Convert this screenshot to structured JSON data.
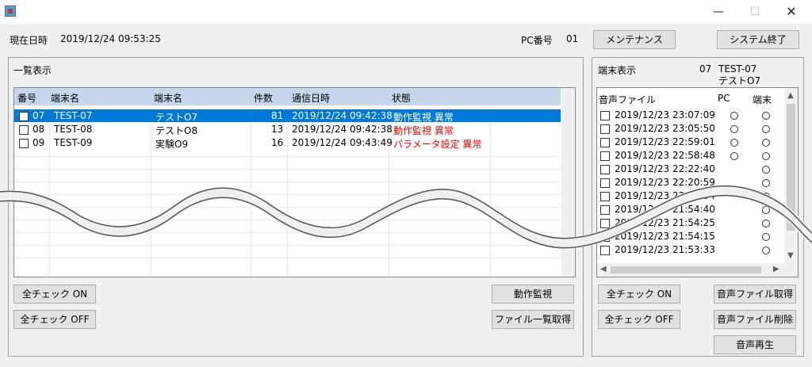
{
  "window": {
    "min_glyph": "—",
    "max_glyph": "☐",
    "close_glyph": "✕"
  },
  "header": {
    "datetime_label": "現在日時",
    "datetime_value": "2019/12/24 09:53:25",
    "pc_label": "PC番号",
    "pc_value": "01",
    "maintenance_button": "メンテナンス",
    "shutdown_button": "システム終了"
  },
  "list_panel": {
    "title": "一覧表示",
    "columns": [
      "番号",
      "端末名",
      "端末名",
      "件数",
      "通信日時",
      "状態"
    ],
    "rows": [
      {
        "no": "07",
        "terminal": "TEST-07",
        "name": "テストO7",
        "count": "81",
        "datetime": "2019/12/24 09:42:38",
        "status": "動作監視 異常"
      },
      {
        "no": "08",
        "terminal": "TEST-08",
        "name": "テストO8",
        "count": "13",
        "datetime": "2019/12/24 09:42:38",
        "status": "動作監視 異常"
      },
      {
        "no": "09",
        "terminal": "TEST-09",
        "name": "実験O9",
        "count": "16",
        "datetime": "2019/12/24 09:43:49",
        "status": "パラメータ設定 異常"
      }
    ],
    "check_on_button": "全チェック ON",
    "check_off_button": "全チェック OFF",
    "monitor_button": "動作監視",
    "filelist_button": "ファイル一覧取得"
  },
  "terminal_panel": {
    "title": "端末表示",
    "terminal_no": "07",
    "terminal_id": "TEST-07",
    "terminal_name": "テストO7",
    "columns": [
      "音声ファイル",
      "PC",
      "端末"
    ],
    "files": [
      {
        "datetime": "2019/12/23 23:07:09",
        "pc": true,
        "terminal": true
      },
      {
        "datetime": "2019/12/23 23:05:50",
        "pc": true,
        "terminal": true
      },
      {
        "datetime": "2019/12/23 22:59:01",
        "pc": true,
        "terminal": true
      },
      {
        "datetime": "2019/12/23 22:58:48",
        "pc": true,
        "terminal": true
      },
      {
        "datetime": "2019/12/23 22:22:40",
        "pc": false,
        "terminal": true
      },
      {
        "datetime": "2019/12/23 22:20:59",
        "pc": false,
        "terminal": true
      },
      {
        "datetime": "2019/12/23 22:19:54",
        "pc": false,
        "terminal": true
      },
      {
        "datetime": "2019/12/23 21:54:40",
        "pc": false,
        "terminal": true
      },
      {
        "datetime": "2019/12/23 21:54:25",
        "pc": false,
        "terminal": true
      },
      {
        "datetime": "2019/12/23 21:54:15",
        "pc": false,
        "terminal": true
      },
      {
        "datetime": "2019/12/23 21:53:33",
        "pc": false,
        "terminal": true
      }
    ],
    "check_on_button": "全チェック ON",
    "check_off_button": "全チェック OFF",
    "get_audio_button": "音声ファイル取得",
    "delete_audio_button": "音声ファイル削除",
    "play_audio_button": "音声再生"
  },
  "colors": {
    "selected_row": "#0078d7",
    "error_text": "#ff0000",
    "header_row": "#c6d6ec"
  }
}
